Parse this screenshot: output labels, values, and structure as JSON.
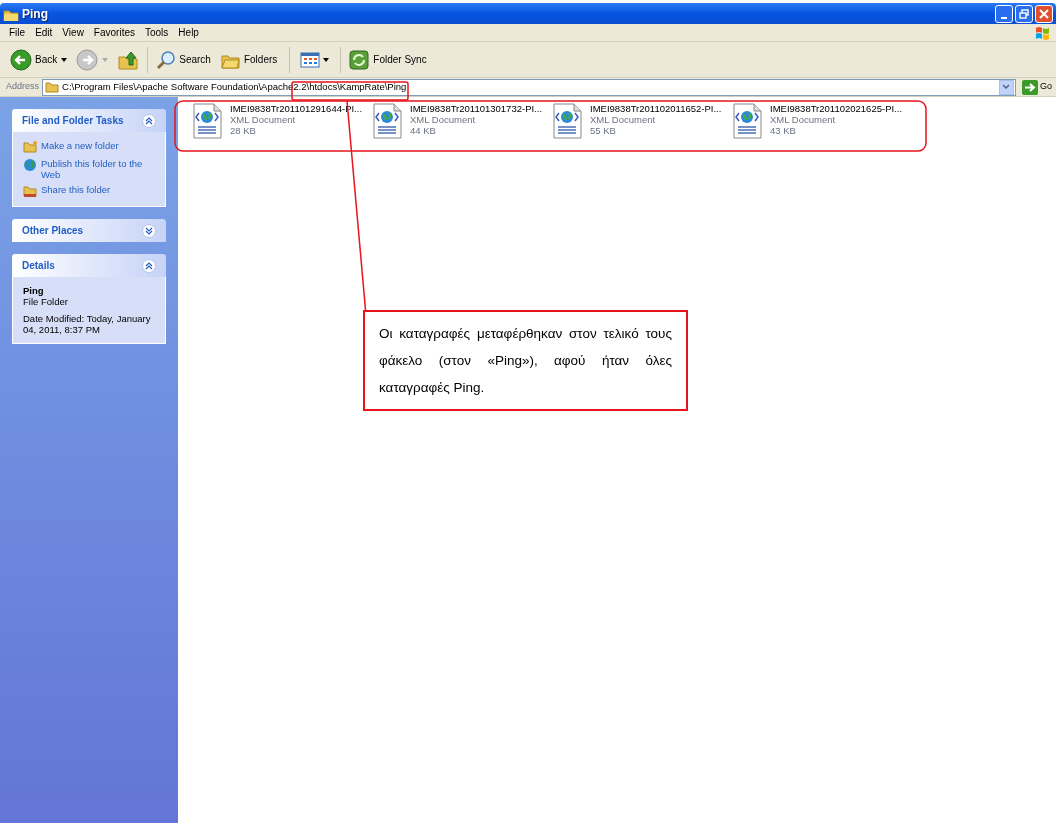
{
  "window": {
    "title": "Ping"
  },
  "menu": [
    "File",
    "Edit",
    "View",
    "Favorites",
    "Tools",
    "Help"
  ],
  "toolbar": [
    {
      "kind": "back",
      "label": "Back",
      "disabled": false
    },
    {
      "kind": "forward",
      "disabled": true
    },
    {
      "kind": "up"
    },
    {
      "kind": "search",
      "label": "Search"
    },
    {
      "kind": "folders",
      "label": "Folders"
    },
    {
      "kind": "views"
    },
    {
      "kind": "sync",
      "label": "Folder Sync"
    }
  ],
  "address": {
    "label": "Address",
    "value": "C:\\Program Files\\Apache Software Foundation\\Apache2.2\\htdocs\\KampRate\\Ping",
    "go": "Go"
  },
  "sidebar": [
    {
      "title": "File and Folder Tasks",
      "expanded": true,
      "kind": "tasks",
      "items": [
        {
          "kind": "newfolder",
          "label": "Make a new folder"
        },
        {
          "kind": "publish",
          "label": "Publish this folder to the Web"
        },
        {
          "kind": "share",
          "label": "Share this folder"
        }
      ]
    },
    {
      "title": "Other Places",
      "expanded": false
    },
    {
      "title": "Details",
      "expanded": true,
      "kind": "details",
      "name": "Ping",
      "type": "File Folder",
      "modified": "Date Modified: Today, January 04, 2011, 8:37 PM"
    }
  ],
  "files": [
    {
      "name": "IMEI9838Tr201101291644-PI...",
      "type": "XML Document",
      "size": "28 KB"
    },
    {
      "name": "IMEI9838Tr201101301732-PI...",
      "type": "XML Document",
      "size": "44 KB"
    },
    {
      "name": "IMEI9838Tr201102011652-PI...",
      "type": "XML Document",
      "size": "55 KB"
    },
    {
      "name": "IMEI9838Tr201102021625-PI...",
      "type": "XML Document",
      "size": "43 KB"
    }
  ],
  "annotation": {
    "text": "Οι καταγραφές μεταφέρθηκαν στον τελικό τους φάκελο (στον «Ping»), αφού ήταν όλες καταγραφές Ping."
  }
}
